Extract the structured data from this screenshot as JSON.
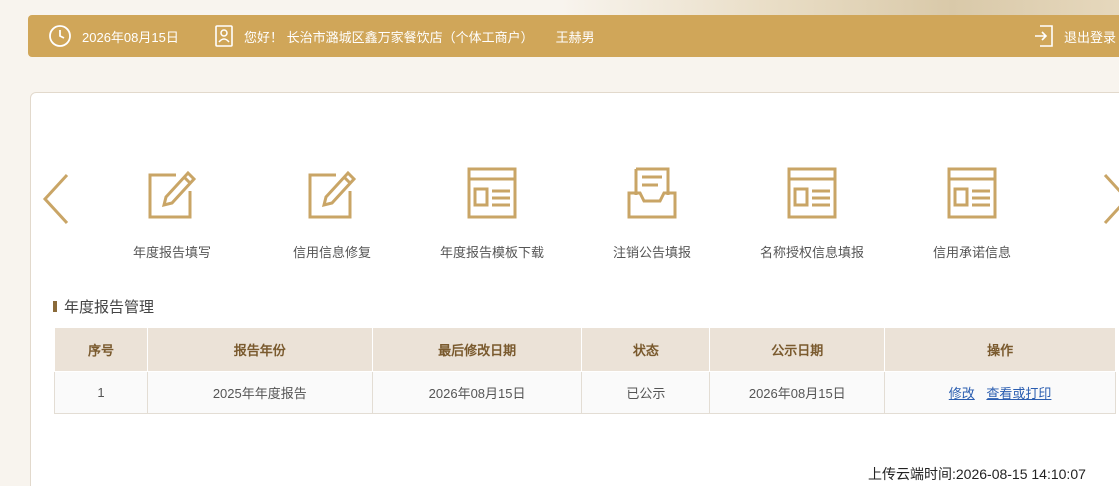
{
  "header": {
    "date": "2026年08月15日",
    "greeting": "您好！ 长治市潞城区鑫万家餐饮店（个体工商户）",
    "user_name": "王赫男",
    "logout_label": "退出登录"
  },
  "menu": {
    "items": [
      {
        "label": "年度报告填写",
        "icon": "edit-icon"
      },
      {
        "label": "信用信息修复",
        "icon": "edit-icon"
      },
      {
        "label": "年度报告模板下载",
        "icon": "document-icon"
      },
      {
        "label": "注销公告填报",
        "icon": "inbox-icon"
      },
      {
        "label": "名称授权信息填报",
        "icon": "document-icon"
      },
      {
        "label": "信用承诺信息",
        "icon": "document-icon"
      }
    ]
  },
  "section": {
    "title": "年度报告管理"
  },
  "table": {
    "headers": [
      "序号",
      "报告年份",
      "最后修改日期",
      "状态",
      "公示日期",
      "操作"
    ],
    "rows": [
      {
        "index": "1",
        "year": "2025年年度报告",
        "modified": "2026年08月15日",
        "status": "已公示",
        "publish_date": "2026年08月15日",
        "action_edit": "修改",
        "action_view": "查看或打印"
      }
    ]
  },
  "footer": {
    "upload_time": "上传云端时间:2026-08-15 14:10:07"
  },
  "colors": {
    "accent": "#d0a659",
    "header_bg": "#ebe2d7",
    "link": "#2a5db0"
  }
}
